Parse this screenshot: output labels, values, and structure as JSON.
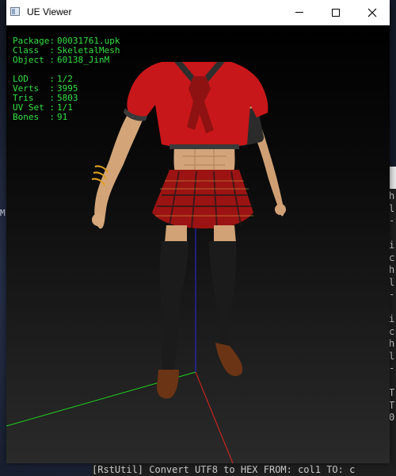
{
  "window": {
    "title": "UE Viewer"
  },
  "info": {
    "package": {
      "label": "Package:",
      "value": "00031761.upk"
    },
    "class": {
      "label": "Class  :",
      "value": "SkeletalMesh"
    },
    "object": {
      "label": "Object :",
      "value": "60138_JinM"
    },
    "lod": {
      "label": "LOD    :",
      "value": "1/2"
    },
    "verts": {
      "label": "Verts  :",
      "value": "3995"
    },
    "tris": {
      "label": "Tris   :",
      "value": "5803"
    },
    "uvset": {
      "label": "UV Set :",
      "value": "1/1"
    },
    "bones": {
      "label": "Bones  :",
      "value": "91"
    }
  },
  "background": {
    "desktop_letter": "M",
    "console_lines": "h\nl\n-\n\ni\nc\nh\nl\n-\n\ni\nc\nh\nl\n-\n\nT\nT\n0",
    "bottom_console": "[RstUtil] Convert UTF8 to HEX  FROM: col1  TO: c"
  },
  "colors": {
    "info_text": "#33e044",
    "axis_x": "#e0261d",
    "axis_y": "#1fd11f",
    "axis_z": "#2a2ae0",
    "shirt": "#c8171a",
    "skirt_plaid": "#9c1313"
  }
}
